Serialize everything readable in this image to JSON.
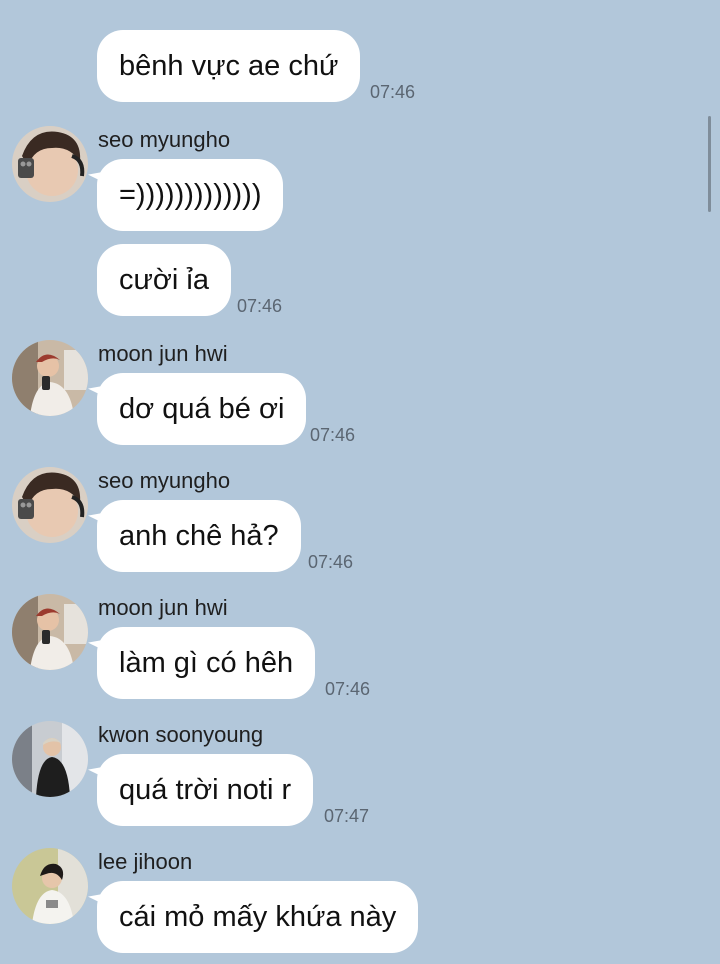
{
  "messages": [
    {
      "sender": "",
      "text": "bênh vực ae chứ",
      "time": "07:46"
    },
    {
      "sender": "seo myungho",
      "text": "=)))))))))))))",
      "time": ""
    },
    {
      "sender": "",
      "text": "cười ỉa",
      "time": "07:46"
    },
    {
      "sender": "moon jun hwi",
      "text": "dơ quá bé ơi",
      "time": "07:46"
    },
    {
      "sender": "seo myungho",
      "text": "anh chê hả?",
      "time": "07:46"
    },
    {
      "sender": "moon jun hwi",
      "text": "làm gì có hêh",
      "time": "07:46"
    },
    {
      "sender": "kwon soonyoung",
      "text": "quá trời noti r",
      "time": "07:47"
    },
    {
      "sender": "lee jihoon",
      "text": "cái mỏ mấy khứa này",
      "time": ""
    }
  ],
  "avatars": [
    "seo-myungho-avatar",
    "moon-jun-hwi-avatar",
    "kwon-soonyoung-avatar",
    "lee-jihoon-avatar"
  ],
  "colors": {
    "background": "#b2c7da",
    "bubble": "#ffffff",
    "time": "#5b6672"
  }
}
